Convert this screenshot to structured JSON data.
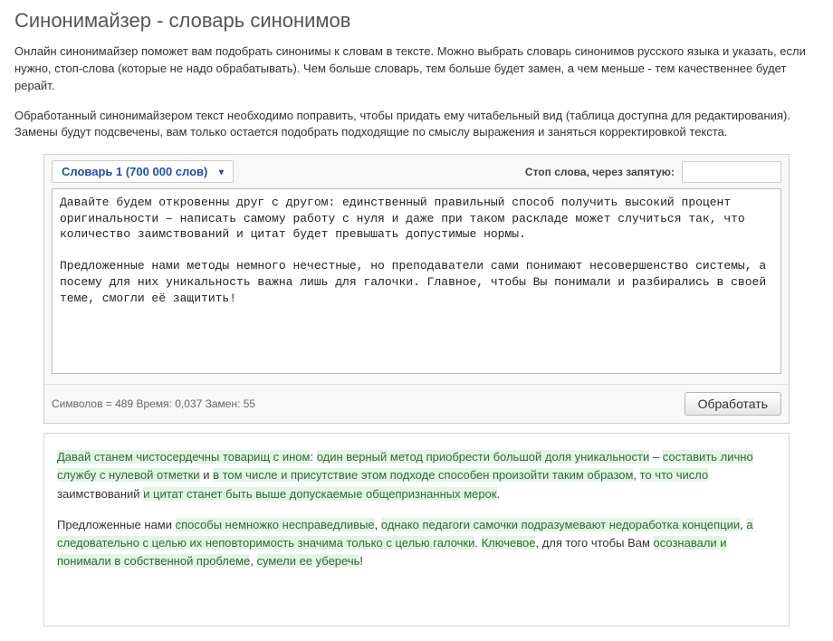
{
  "title": "Синонимайзер - словарь синонимов",
  "intro1": "Онлайн синонимайзер поможет вам подобрать синонимы к словам в тексте. Можно выбрать словарь синонимов русского языка и указать, если нужно, стоп-слова (которые не надо обрабатывать). Чем больше словарь, тем больше будет замен, а чем меньше - тем качественнее будет рерайт.",
  "intro2": "Обработанный синонимайзером текст необходимо поправить, чтобы придать ему читабельный вид (таблица доступна для редактирования). Замены будут подсвечены, вам только остается подобрать подходящие по смыслу выражения и заняться корректировкой текста.",
  "dict_select": "Словарь 1 (700 000 слов)",
  "stop_label": "Стоп слова, через запятую:",
  "stop_value": "",
  "source_text": "Давайте будем откровенны друг с другом: единственный правильный способ получить высокий процент оригинальности – написать самому работу с нуля и даже при таком раскладе может случиться так, что количество заимствований и цитат будет превышать допустимые нормы.\n\nПредложенные нами методы немного нечестные, но преподаватели сами понимают несовершенство системы, а посему для них уникальность важна лишь для галочки. Главное, чтобы Вы понимали и разбирались в своей теме, смогли её защитить!",
  "stats": "Символов = 489   Время: 0,037   Замен: 55",
  "process_label": "Обработать",
  "output": {
    "p1": {
      "s1": "Давай станем чистосердечны товарищ с ином",
      "t1": ": ",
      "s2": "один верный метод приобрести большой доля уникальности",
      "t2": " – ",
      "s3": "составить лично службу с нулевой отметки",
      "t3": " и ",
      "s4": "в том числе и присутствие этом подходе способен произойти таким образом",
      "t4": ", ",
      "s5": "то что число",
      "t5": " заимствований ",
      "s6": "и цитат станет быть выше допускаемые общепризнанных мерок",
      "t6": "."
    },
    "p2": {
      "t0": "Предложенные нами ",
      "s1": "способы немножко несправедливые",
      "t1": ", ",
      "s2": "однако педагоги самочки подразумевают недоработка концепции",
      "t2": ", ",
      "s3": "а следовательно с целью их неповторимость значима только с целью галочки",
      "t3": ". ",
      "s4": "Ключевое",
      "t4": ", для того чтобы Вам ",
      "s5": "осознавали и понимали в собственной проблеме",
      "t5": ", ",
      "s6": "сумели ее уберечь",
      "t6": "!"
    }
  }
}
